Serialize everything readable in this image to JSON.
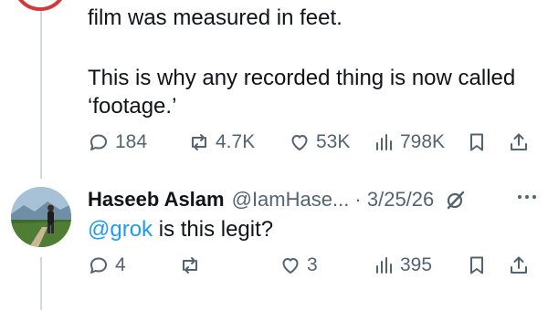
{
  "first_tweet": {
    "text_line_1": "film was measured in feet.",
    "text_para_2": "This is why any recorded thing is now called\n‘footage.’",
    "actions": {
      "replies": "184",
      "reposts": "4.7K",
      "likes": "53K",
      "views": "798K"
    }
  },
  "reply_tweet": {
    "author_name": "Haseeb Aslam",
    "handle_date": "@IamHase... · 3/25/26",
    "mention": "@grok",
    "text": " is this legit?",
    "actions": {
      "replies": "4",
      "reposts": "",
      "likes": "3",
      "views": "395"
    }
  },
  "icons": [
    "reply-icon",
    "repost-icon",
    "like-icon",
    "views-icon",
    "bookmark-icon",
    "share-icon",
    "grok-icon",
    "more-icon"
  ],
  "colors": {
    "text": "#0f1419",
    "secondary": "#536471",
    "link": "#1d9bf0",
    "thread_line": "#cfd9de"
  }
}
